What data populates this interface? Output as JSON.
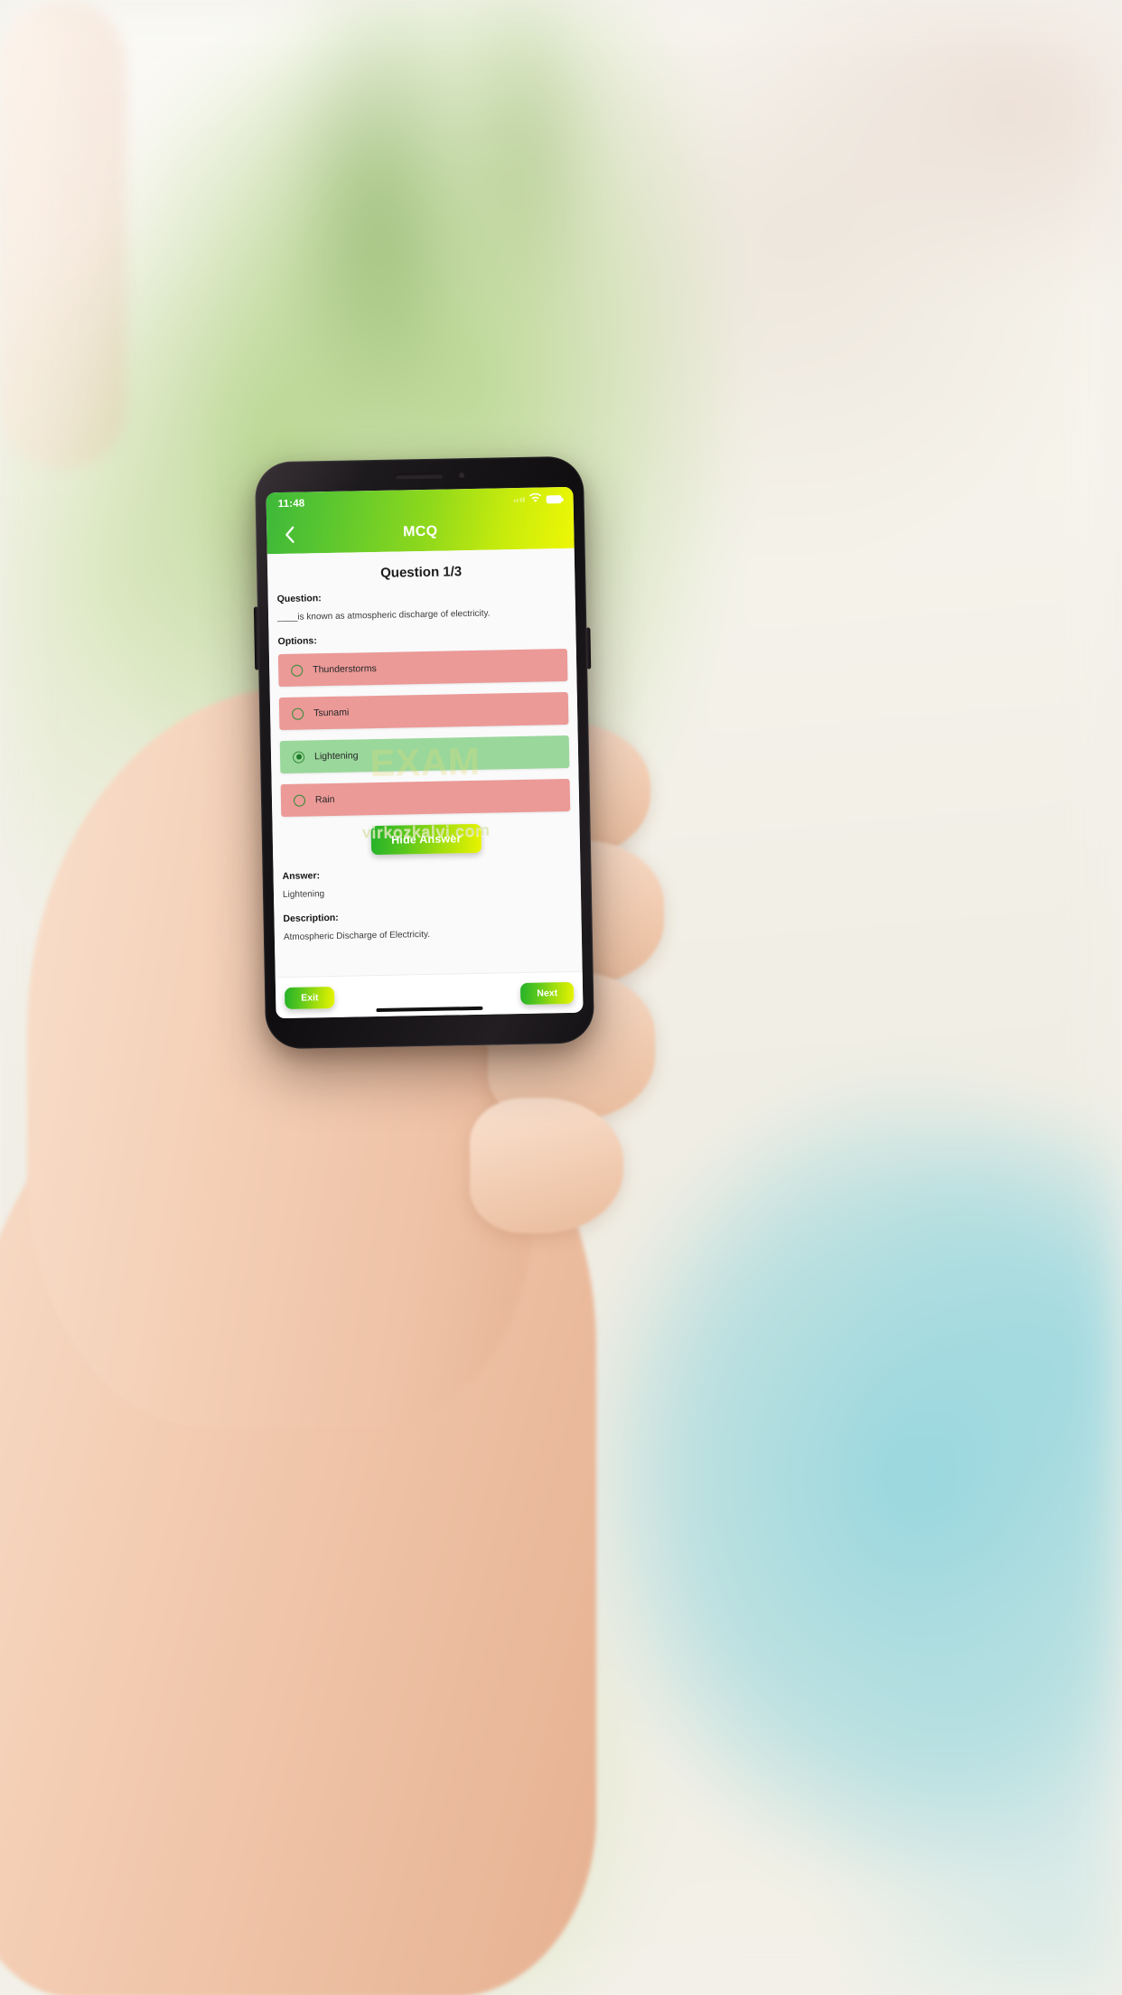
{
  "statusbar": {
    "time": "11:48",
    "wifi_icon": "wifi-icon",
    "battery_icon": "battery-full-icon",
    "signal_icon": "signal-dots-icon"
  },
  "navbar": {
    "back_icon": "chevron-left-icon",
    "title": "MCQ"
  },
  "quiz": {
    "progress_title": "Question 1/3",
    "question_label": "Question:",
    "question_text": "____is known as atmospheric discharge of electricity.",
    "options_label": "Options:",
    "options": [
      {
        "label": "Thunderstorms",
        "state": "wrong",
        "selected": false
      },
      {
        "label": "Tsunami",
        "state": "wrong",
        "selected": false
      },
      {
        "label": "Lightening",
        "state": "right",
        "selected": true
      },
      {
        "label": "Rain",
        "state": "wrong",
        "selected": false
      }
    ],
    "toggle_answer_label": "Hide Answer",
    "answer_label": "Answer:",
    "answer_text": "Lightening",
    "description_label": "Description:",
    "description_text": "Atmospheric Discharge of Electricity."
  },
  "watermark": {
    "site": "virkozkalvi.com",
    "faint": "EXAM"
  },
  "bottombar": {
    "exit_label": "Exit",
    "next_label": "Next"
  },
  "colors": {
    "accent_green": "#24b12a",
    "accent_yellow": "#e9f400",
    "option_wrong": "#eb9a98",
    "option_right": "#9ad79b",
    "radio_border": "#2f8b36"
  }
}
